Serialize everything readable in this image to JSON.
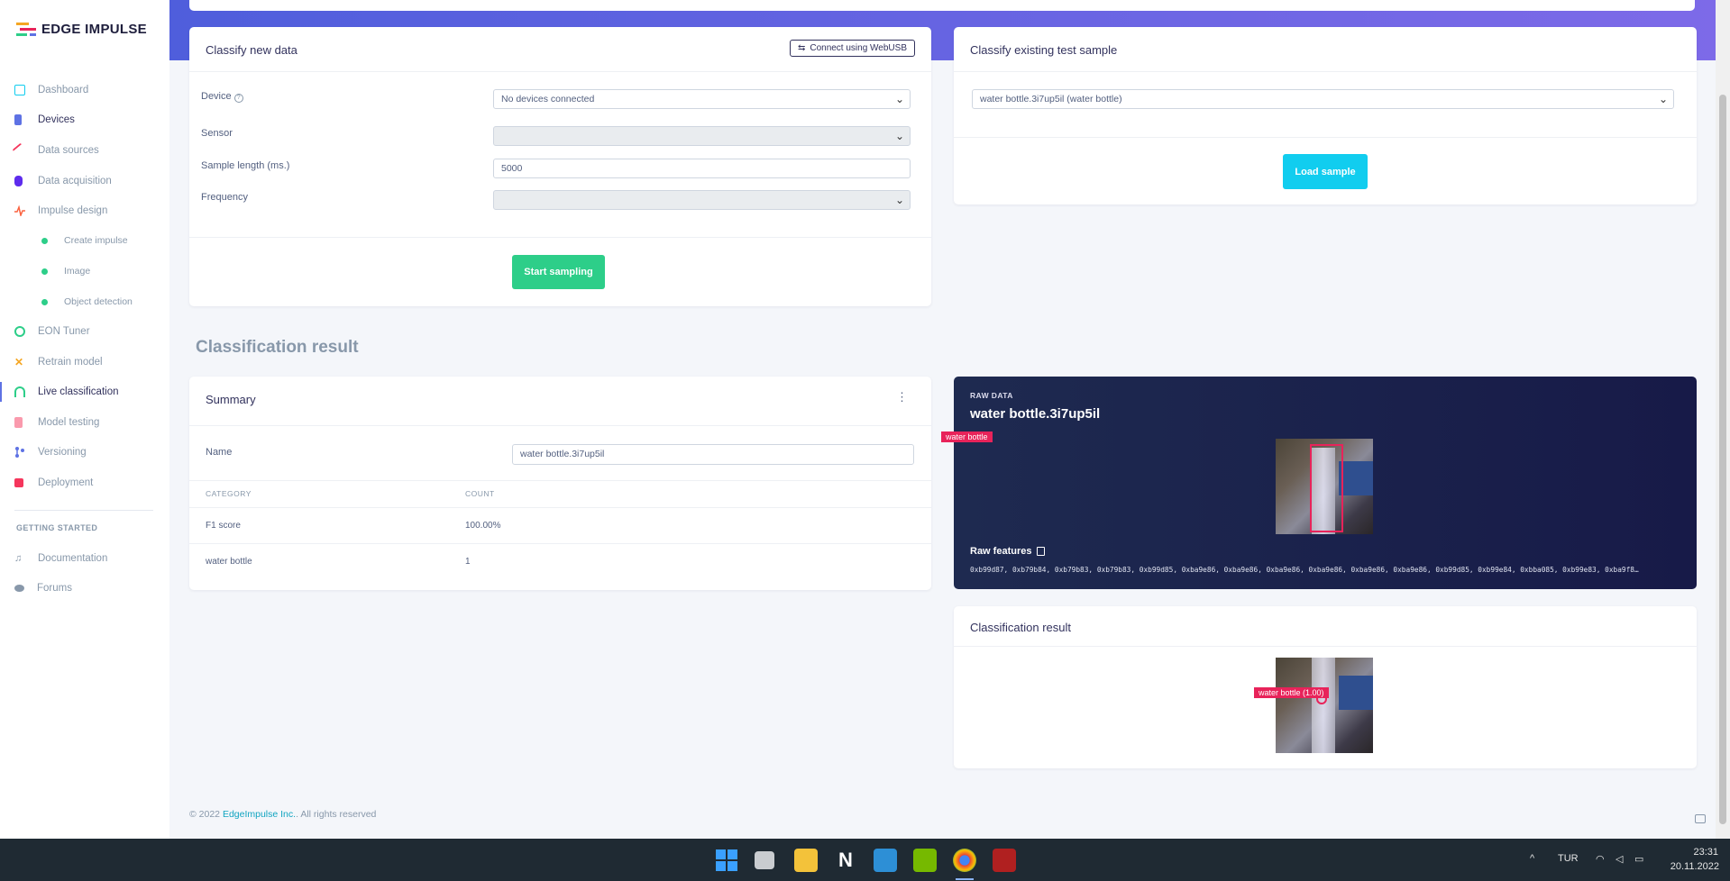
{
  "brand": {
    "name": "EDGE IMPULSE",
    "colors": [
      "#f5a623",
      "#e8235a",
      "#2dce89",
      "#5e72e4"
    ]
  },
  "sidebar": {
    "items": [
      {
        "label": "Dashboard",
        "icon": "monitor-icon",
        "color": "#11cdef"
      },
      {
        "label": "Devices",
        "icon": "device-icon",
        "color": "#5e72e4"
      },
      {
        "label": "Data sources",
        "icon": "data-sources-icon",
        "color": "#f5365c"
      },
      {
        "label": "Data acquisition",
        "icon": "database-icon",
        "color": "#5e2ced"
      },
      {
        "label": "Impulse design",
        "icon": "pulse-icon",
        "color": "#fb6340"
      },
      {
        "label": "Create impulse",
        "icon": "dot-icon",
        "color": "#2dce89"
      },
      {
        "label": "Image",
        "icon": "dot-icon",
        "color": "#2dce89"
      },
      {
        "label": "Object detection",
        "icon": "dot-icon",
        "color": "#2dce89"
      },
      {
        "label": "EON Tuner",
        "icon": "gauge-icon",
        "color": "#2dce89"
      },
      {
        "label": "Retrain model",
        "icon": "retrain-icon",
        "color": "#f5a623"
      },
      {
        "label": "Live classification",
        "icon": "live-icon",
        "color": "#2dce89"
      },
      {
        "label": "Model testing",
        "icon": "clipboard-icon",
        "color": "#f5365c"
      },
      {
        "label": "Versioning",
        "icon": "branch-icon",
        "color": "#5e72e4"
      },
      {
        "label": "Deployment",
        "icon": "box-icon",
        "color": "#f5365c"
      }
    ],
    "section_label": "GETTING STARTED",
    "getting_started": [
      {
        "label": "Documentation",
        "icon": "docs-icon"
      },
      {
        "label": "Forums",
        "icon": "chat-icon"
      }
    ]
  },
  "classify_new": {
    "title": "Classify new data",
    "connect_label": "Connect using WebUSB",
    "device_label": "Device",
    "device_value": "No devices connected",
    "sensor_label": "Sensor",
    "sample_length_label": "Sample length (ms.)",
    "sample_length_value": "5000",
    "frequency_label": "Frequency",
    "start_label": "Start sampling"
  },
  "classify_existing": {
    "title": "Classify existing test sample",
    "sample_value": "water bottle.3i7up5il (water bottle)",
    "load_label": "Load sample"
  },
  "result_heading": "Classification result",
  "summary": {
    "title": "Summary",
    "name_label": "Name",
    "name_value": "water bottle.3i7up5il",
    "col_category": "CATEGORY",
    "col_count": "COUNT",
    "rows": [
      {
        "category": "F1 score",
        "count": "100.00%"
      },
      {
        "category": "water bottle",
        "count": "1"
      }
    ]
  },
  "raw_data": {
    "kicker": "RAW DATA",
    "title": "water bottle.3i7up5il",
    "box_label": "water bottle",
    "features_label": "Raw features",
    "features": "0xb99d87, 0xb79b84, 0xb79b83, 0xb79b83, 0xb99d85, 0xba9e86, 0xba9e86, 0xba9e86, 0xba9e86, 0xba9e86, 0xba9e86, 0xb99d85, 0xb99e84, 0xbba085, 0xb99e83, 0xba9f8…"
  },
  "classification_result": {
    "title": "Classification result",
    "box_label": "water bottle (1.00)"
  },
  "footer": {
    "year": "© 2022",
    "company": "EdgeImpulse Inc.",
    "rights": "All rights reserved"
  },
  "taskbar": {
    "lang": "TUR",
    "time": "23:31",
    "date": "20.11.2022"
  }
}
